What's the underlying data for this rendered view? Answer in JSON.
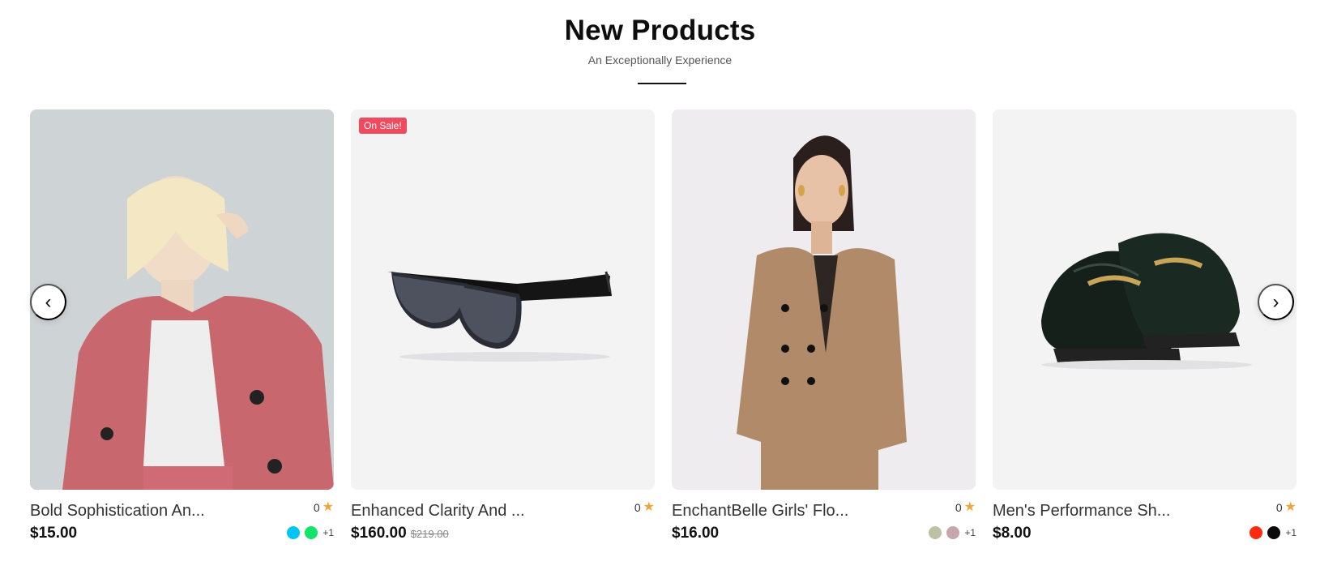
{
  "header": {
    "title": "New Products",
    "subtitle": "An Exceptionally Experience"
  },
  "carousel": {
    "prev_icon": "‹",
    "next_icon": "›"
  },
  "products": [
    {
      "name": "Bold Sophistication An...",
      "rating": "0",
      "price": "$15.00",
      "old_price": "",
      "badge": "",
      "swatches": [
        "#00c4f5",
        "#12e36a"
      ],
      "more_colors": "+1",
      "image": "woman-in-pink-blazer"
    },
    {
      "name": "Enhanced Clarity And ...",
      "rating": "0",
      "price": "$160.00",
      "old_price": "$219.00",
      "badge": "On Sale!",
      "swatches": [],
      "more_colors": "",
      "image": "black-sunglasses"
    },
    {
      "name": "EnchantBelle Girls' Flo...",
      "rating": "0",
      "price": "$16.00",
      "old_price": "",
      "badge": "",
      "swatches": [
        "#bfc0a1",
        "#c8a7ab"
      ],
      "more_colors": "+1",
      "image": "woman-in-beige-suit"
    },
    {
      "name": "Men's Performance Sh...",
      "rating": "0",
      "price": "$8.00",
      "old_price": "",
      "badge": "",
      "swatches": [
        "#ff2a10",
        "#0a0a0a"
      ],
      "more_colors": "+1",
      "image": "black-patent-loafers"
    }
  ],
  "colors": {
    "badge": "#ef4a5d",
    "star": "#f2a33a"
  }
}
